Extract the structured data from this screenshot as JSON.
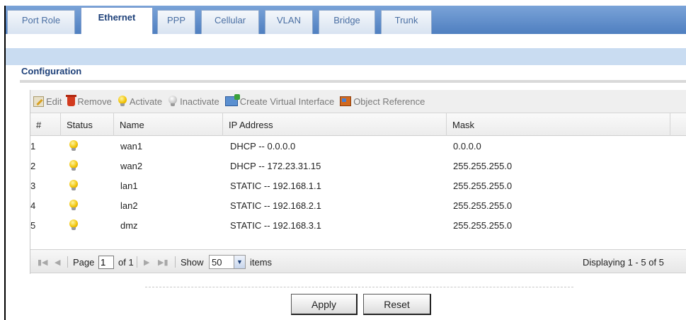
{
  "tabs": [
    {
      "label": "Port Role",
      "active": false
    },
    {
      "label": "Ethernet",
      "active": true
    },
    {
      "label": "PPP",
      "active": false
    },
    {
      "label": "Cellular",
      "active": false
    },
    {
      "label": "VLAN",
      "active": false
    },
    {
      "label": "Bridge",
      "active": false
    },
    {
      "label": "Trunk",
      "active": false
    }
  ],
  "section": {
    "title": "Configuration"
  },
  "toolbar": {
    "edit": "Edit",
    "remove": "Remove",
    "activate": "Activate",
    "inactivate": "Inactivate",
    "create_virtual": "Create Virtual Interface",
    "object_reference": "Object Reference"
  },
  "table": {
    "headers": [
      "#",
      "Status",
      "Name",
      "IP Address",
      "Mask"
    ],
    "rows": [
      {
        "num": "1",
        "status": "active",
        "name": "wan1",
        "ip": "DHCP -- 0.0.0.0",
        "mask": "0.0.0.0"
      },
      {
        "num": "2",
        "status": "active",
        "name": "wan2",
        "ip": "DHCP -- 172.23.31.15",
        "mask": "255.255.255.0"
      },
      {
        "num": "3",
        "status": "active",
        "name": "lan1",
        "ip": "STATIC -- 192.168.1.1",
        "mask": "255.255.255.0"
      },
      {
        "num": "4",
        "status": "active",
        "name": "lan2",
        "ip": "STATIC -- 192.168.2.1",
        "mask": "255.255.255.0"
      },
      {
        "num": "5",
        "status": "active",
        "name": "dmz",
        "ip": "STATIC -- 192.168.3.1",
        "mask": "255.255.255.0"
      }
    ]
  },
  "pager": {
    "page_label": "Page",
    "page_value": "1",
    "of_label": "of 1",
    "show_label": "Show",
    "show_value": "50",
    "items_label": "items",
    "displaying": "Displaying 1 - 5 of 5"
  },
  "buttons": {
    "apply": "Apply",
    "reset": "Reset"
  },
  "colors": {
    "tabbar": "#5b88c6",
    "band": "#c9dcf1",
    "title": "#1c3f78",
    "bulb_on": "#f0c000"
  }
}
